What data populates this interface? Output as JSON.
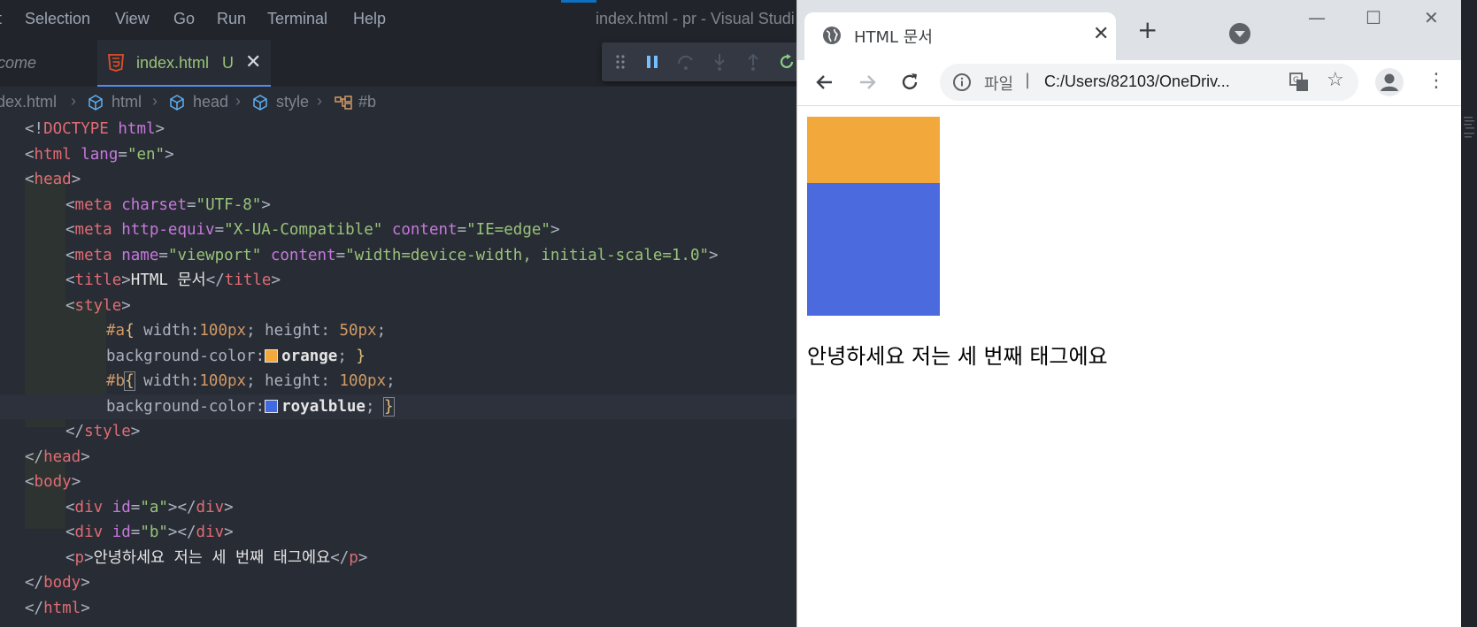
{
  "vscode": {
    "menu": [
      "t",
      "Selection",
      "View",
      "Go",
      "Run",
      "Terminal",
      "Help"
    ],
    "window_title": "index.html - pr - Visual Studi",
    "tabs": {
      "welcome": "lcome",
      "index": "index.html",
      "index_badge": "U",
      "close_glyph": "✕"
    },
    "breadcrumb": [
      "dex.html",
      "html",
      "head",
      "style",
      "#b"
    ],
    "code": {
      "l1": [
        "<!",
        "DOCTYPE",
        " html",
        ">"
      ],
      "l2": [
        "<",
        "html",
        " lang",
        "=",
        "\"en\"",
        ">"
      ],
      "l3": [
        "<",
        "head",
        ">"
      ],
      "l4": [
        "<",
        "meta",
        " charset",
        "=",
        "\"UTF-8\"",
        ">"
      ],
      "l5": [
        "<",
        "meta",
        " http-equiv",
        "=",
        "\"X-UA-Compatible\"",
        " content",
        "=",
        "\"IE=edge\"",
        ">"
      ],
      "l6": [
        "<",
        "meta",
        " name",
        "=",
        "\"viewport\"",
        " content",
        "=",
        "\"width=device-width, initial-scale=1.0\"",
        ">"
      ],
      "l7": [
        "<",
        "title",
        ">",
        "HTML 문서",
        "</",
        "title",
        ">"
      ],
      "l8": [
        "<",
        "style",
        ">"
      ],
      "l9": [
        "#a",
        "{",
        " width:",
        "100px",
        "; height: ",
        "50px",
        ";"
      ],
      "l10": [
        "background-color:",
        "orange",
        "; ",
        "}"
      ],
      "l11": [
        "#b",
        "{",
        " width:",
        "100px",
        "; height: ",
        "100px",
        ";"
      ],
      "l12": [
        "background-color:",
        "royalblue",
        "; ",
        "}"
      ],
      "l13": [
        "</",
        "style",
        ">"
      ],
      "l14": [
        "</",
        "head",
        ">"
      ],
      "l15": [
        "<",
        "body",
        ">"
      ],
      "l16": [
        "<",
        "div",
        " id",
        "=",
        "\"a\"",
        "></",
        "div",
        ">"
      ],
      "l17": [
        "<",
        "div",
        " id",
        "=",
        "\"b\"",
        "></",
        "div",
        ">"
      ],
      "l18": [
        "<",
        "p",
        ">",
        "안녕하세요 저는 세 번째 태그에요",
        "</",
        "p",
        ">"
      ],
      "l19": [
        "</",
        "body",
        ">"
      ],
      "l20": [
        "</",
        "html",
        ">"
      ]
    }
  },
  "chrome": {
    "tab_title": "HTML 문서",
    "tab_close": "✕",
    "new_tab": "+",
    "window_buttons": {
      "minimize": "—",
      "maximize": "☐",
      "close": "✕"
    },
    "omnibox": {
      "scheme_label": "파일",
      "separator": "|",
      "url": "C:/Users/82103/OneDriv..."
    },
    "star": "☆",
    "kebab": "⋮",
    "page": {
      "greeting": "안녕하세요 저는 세 번째 태그에요"
    }
  },
  "colors": {
    "orange_box": "#f2a83b",
    "royalblue_box": "#4a6ade",
    "editor_bg": "#282c34",
    "tag": "#e06c75",
    "string": "#98c379"
  },
  "icons": [
    "html5-icon",
    "pause-icon",
    "step-over-icon",
    "step-into-icon",
    "step-out-icon",
    "restart-icon",
    "drag-handle-icon",
    "globe-icon",
    "back-icon",
    "forward-icon",
    "reload-icon",
    "info-icon",
    "translate-icon",
    "star-icon",
    "profile-icon",
    "more-icon"
  ]
}
